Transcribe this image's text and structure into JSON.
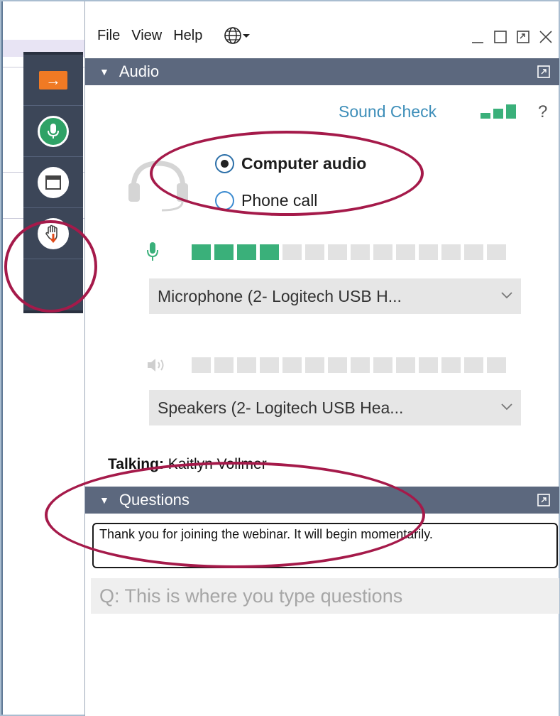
{
  "menubar": {
    "items": [
      "File",
      "View",
      "Help"
    ]
  },
  "audio": {
    "header": "Audio",
    "sound_check": "Sound Check",
    "help": "?",
    "options": {
      "computer_audio": "Computer audio",
      "phone_call": "Phone call"
    },
    "selected_option": "Computer audio",
    "microphone": {
      "level_segments_on": 4,
      "level_segments_total": 14,
      "device": "Microphone (2- Logitech USB H..."
    },
    "speakers": {
      "level_segments_on": 0,
      "level_segments_total": 14,
      "device": "Speakers (2- Logitech USB Hea..."
    }
  },
  "talking": {
    "label": "Talking:",
    "name": "Kaitlyn Vollmer"
  },
  "questions": {
    "header": "Questions",
    "message": "Thank you for joining the webinar. It will begin momentarily.",
    "input_placeholder": "Q: This is where you type questions"
  },
  "colors": {
    "accent_green": "#3ab07a",
    "header_bg": "#5c687e",
    "annotation": "#a51a4a",
    "link": "#3d8eb9",
    "toolbar_bg": "#3c4658",
    "arrow_orange": "#f07a24"
  },
  "icons": {
    "toolbar": [
      "arrow-right-icon",
      "microphone-icon",
      "window-icon",
      "raise-hand-icon"
    ],
    "window_controls": [
      "minimize-icon",
      "maximize-icon",
      "restore-icon",
      "close-icon"
    ],
    "menu": [
      "globe-icon",
      "dropdown-arrow-icon"
    ]
  }
}
